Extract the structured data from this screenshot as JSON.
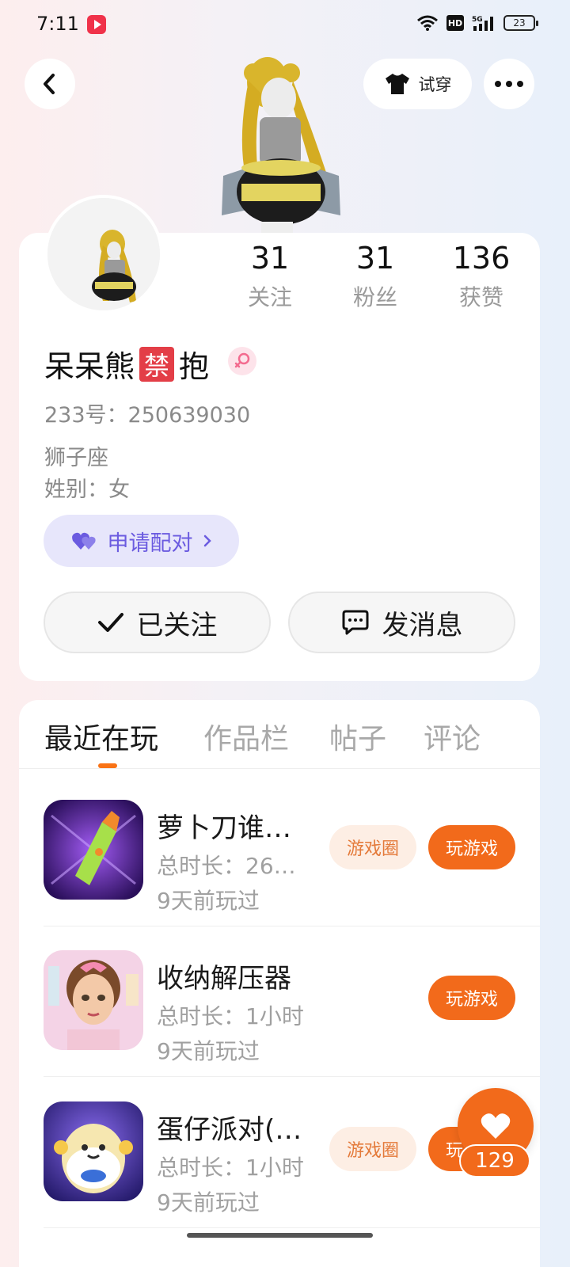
{
  "status_bar": {
    "time": "7:11",
    "hd": "HD",
    "battery": "23"
  },
  "header": {
    "tryon_label": "试穿"
  },
  "profile": {
    "nickname_part1": "呆呆熊",
    "nickname_badge": "禁",
    "nickname_part2": "抱",
    "uid": "233号：250639030",
    "zodiac": "狮子座",
    "gender": "姓别：女",
    "match_label": "申请配对",
    "follow_label": "已关注",
    "message_label": "发消息",
    "stats": [
      {
        "value": "31",
        "label": "关注"
      },
      {
        "value": "31",
        "label": "粉丝"
      },
      {
        "value": "136",
        "label": "获赞"
      }
    ]
  },
  "tabs": [
    "最近在玩",
    "作品栏",
    "帖子",
    "评论"
  ],
  "games": [
    {
      "title": "萝卜刀谁…",
      "duration": "总时长：26…",
      "last": "9天前玩过",
      "circle_label": "游戏圈",
      "play_label": "玩游戏"
    },
    {
      "title": "收纳解压器",
      "duration": "总时长：1小时",
      "last": "9天前玩过",
      "circle_label": "",
      "play_label": "玩游戏"
    },
    {
      "title": "蛋仔派对(…",
      "duration": "总时长：1小时",
      "last": "9天前玩过",
      "circle_label": "游戏圈",
      "play_label": "玩游戏"
    }
  ],
  "floating_like": {
    "count": "129"
  },
  "colors": {
    "accent": "#f26a1b",
    "match_purple": "#6b5be0",
    "ban_red": "#e33e47"
  }
}
